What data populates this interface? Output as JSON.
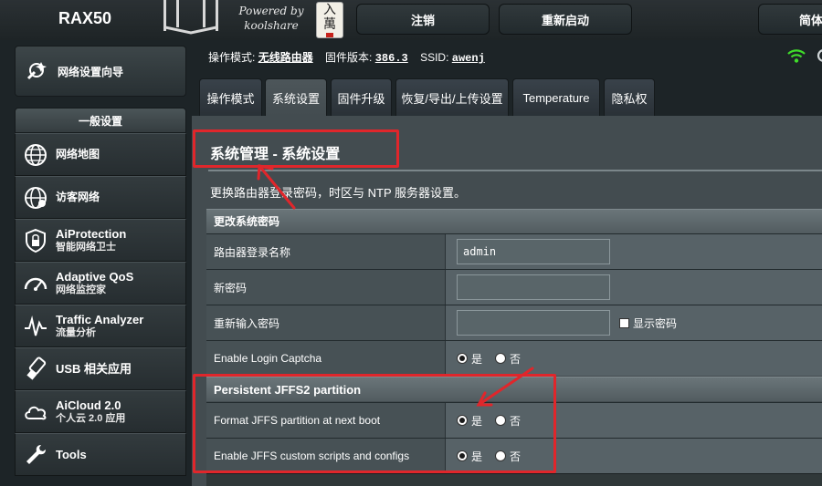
{
  "header": {
    "brand": "RAX50",
    "powered_line1": "Powered by",
    "powered_line2": "koolshare",
    "logo_chars": [
      "入",
      "萬"
    ],
    "logout_label": "注销",
    "reboot_label": "重新启动",
    "lang_label": "简体"
  },
  "sidebar": {
    "wizard_label": "网络设置向导",
    "section_label": "一般设置",
    "items": [
      {
        "main": "网络地图",
        "sub": ""
      },
      {
        "main": "访客网络",
        "sub": ""
      },
      {
        "main": "AiProtection",
        "sub": "智能网络卫士"
      },
      {
        "main": "Adaptive QoS",
        "sub": "网络监控家"
      },
      {
        "main": "Traffic Analyzer",
        "sub": "流量分析"
      },
      {
        "main": "USB 相关应用",
        "sub": ""
      },
      {
        "main": "AiCloud 2.0",
        "sub": "个人云 2.0 应用"
      },
      {
        "main": "Tools",
        "sub": ""
      }
    ]
  },
  "status": {
    "mode_label": "操作模式:",
    "mode_value": "无线路由器",
    "fw_label": "固件版本:",
    "fw_value": "386.3",
    "ssid_label": "SSID:",
    "ssid_value": "awenj"
  },
  "tabs": [
    {
      "label": "操作模式",
      "active": false
    },
    {
      "label": "系统设置",
      "active": true
    },
    {
      "label": "固件升级",
      "active": false
    },
    {
      "label": "恢复/导出/上传设置",
      "active": false
    },
    {
      "label": "Temperature",
      "active": false
    },
    {
      "label": "隐私权",
      "active": false
    }
  ],
  "main": {
    "title": "系统管理 - 系统设置",
    "description": "更换路由器登录密码，时区与 NTP 服务器设置。",
    "password_section": {
      "header": "更改系统密码",
      "login_name_label": "路由器登录名称",
      "login_name_value": "admin",
      "new_password_label": "新密码",
      "new_password_value": "",
      "retype_label": "重新输入密码",
      "retype_value": "",
      "show_password_label": "显示密码",
      "captcha_label": "Enable Login Captcha",
      "captcha_yes": "是",
      "captcha_no": "否"
    },
    "jffs_section": {
      "header": "Persistent JFFS2 partition",
      "format_label": "Format JFFS partition at next boot",
      "format_yes": "是",
      "format_no": "否",
      "scripts_label": "Enable JFFS custom scripts and configs",
      "scripts_yes": "是",
      "scripts_no": "否"
    }
  },
  "colors": {
    "annotation": "#e0262b",
    "wifi": "#3fdc2a"
  },
  "icons": [
    "wizard-icon",
    "globe-icon",
    "guest-network-icon",
    "shield-icon",
    "speedometer-icon",
    "traffic-icon",
    "usb-icon",
    "cloud-icon",
    "wrench-icon",
    "wifi-icon",
    "gear-icon"
  ]
}
